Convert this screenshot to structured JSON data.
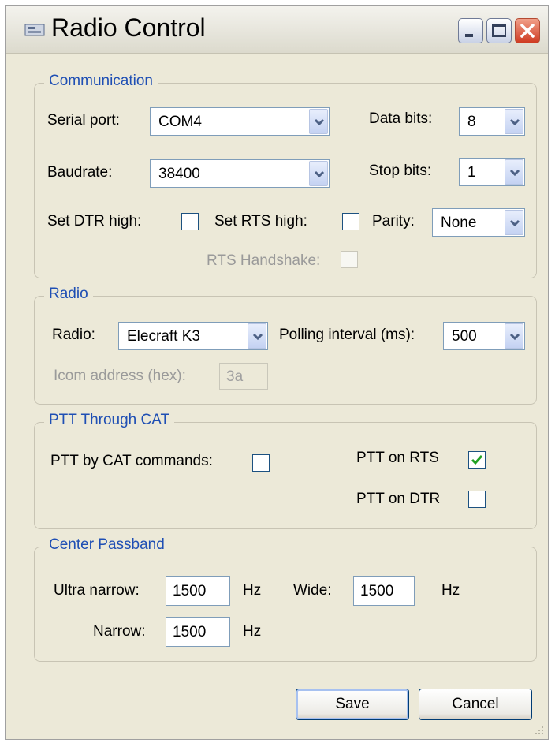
{
  "window": {
    "title": "Radio Control"
  },
  "titlebar_buttons": {
    "minimize_icon": "minimize-icon",
    "maximize_icon": "maximize-icon",
    "close_icon": "close-icon"
  },
  "communication": {
    "legend": "Communication",
    "serial_port_label": "Serial port:",
    "serial_port_value": "COM4",
    "baudrate_label": "Baudrate:",
    "baudrate_value": "38400",
    "data_bits_label": "Data bits:",
    "data_bits_value": "8",
    "stop_bits_label": "Stop bits:",
    "stop_bits_value": "1",
    "set_dtr_label": "Set DTR high:",
    "set_dtr_checked": false,
    "set_rts_label": "Set RTS high:",
    "set_rts_checked": false,
    "parity_label": "Parity:",
    "parity_value": "None",
    "rts_handshake_label": "RTS Handshake:",
    "rts_handshake_checked": false
  },
  "radio": {
    "legend": "Radio",
    "radio_label": "Radio:",
    "radio_value": "Elecraft K3",
    "polling_label": "Polling interval (ms):",
    "polling_value": "500",
    "icom_label": "Icom address (hex):",
    "icom_value": "3a"
  },
  "ptt": {
    "legend": "PTT Through CAT",
    "cat_commands_label": "PTT by CAT commands:",
    "cat_commands_checked": false,
    "on_rts_label": "PTT on RTS",
    "on_rts_checked": true,
    "on_dtr_label": "PTT on DTR",
    "on_dtr_checked": false
  },
  "passband": {
    "legend": "Center Passband",
    "ultra_narrow_label": "Ultra narrow:",
    "ultra_narrow_value": "1500",
    "ultra_narrow_unit": "Hz",
    "wide_label": "Wide:",
    "wide_value": "1500",
    "wide_unit": "Hz",
    "narrow_label": "Narrow:",
    "narrow_value": "1500",
    "narrow_unit": "Hz"
  },
  "buttons": {
    "save": "Save",
    "cancel": "Cancel"
  },
  "colors": {
    "legend_text": "#1f4fb4",
    "window_bg": "#ece9d8",
    "check_mark": "#21a121"
  }
}
